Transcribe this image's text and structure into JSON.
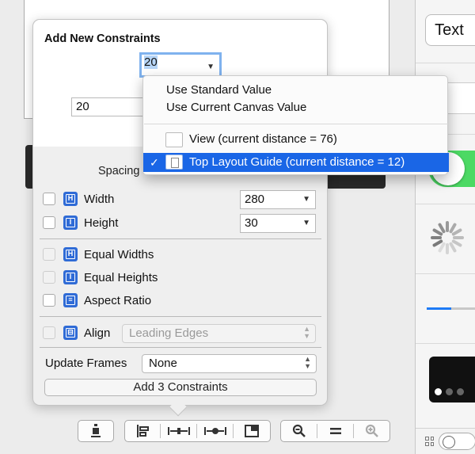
{
  "popover": {
    "title": "Add New Constraints",
    "top_value": "20",
    "left_value": "20",
    "spacing_label": "Spacing",
    "width": {
      "label": "Width",
      "value": "280"
    },
    "height": {
      "label": "Height",
      "value": "30"
    },
    "equal_widths": "Equal Widths",
    "equal_heights": "Equal Heights",
    "aspect_ratio": "Aspect Ratio",
    "align": {
      "label": "Align",
      "value": "Leading Edges"
    },
    "update_frames": {
      "label": "Update Frames",
      "value": "None"
    },
    "add_button": "Add 3 Constraints"
  },
  "menu": {
    "items": [
      {
        "label": "Use Standard Value"
      },
      {
        "label": "Use Current Canvas Value"
      },
      {
        "label": "View (current distance = 76)"
      },
      {
        "label": "Top Layout Guide (current distance = 12)",
        "checked": true
      }
    ]
  },
  "library": {
    "text_button": "Text",
    "progress_fraction": 0.5,
    "page_control_current": 1
  },
  "toolbar": {
    "icons": [
      "embed-icon",
      "align-icon",
      "pin-icon",
      "resolve-issues-icon",
      "resizing-icon",
      "zoom-out-icon",
      "zoom-actual-icon",
      "zoom-in-icon"
    ]
  },
  "colors": {
    "accent": "#1a66e6",
    "constraint_icon": "#2f6bd6",
    "switch_on": "#4cd964",
    "focus_ring": "#7fb2ee"
  }
}
